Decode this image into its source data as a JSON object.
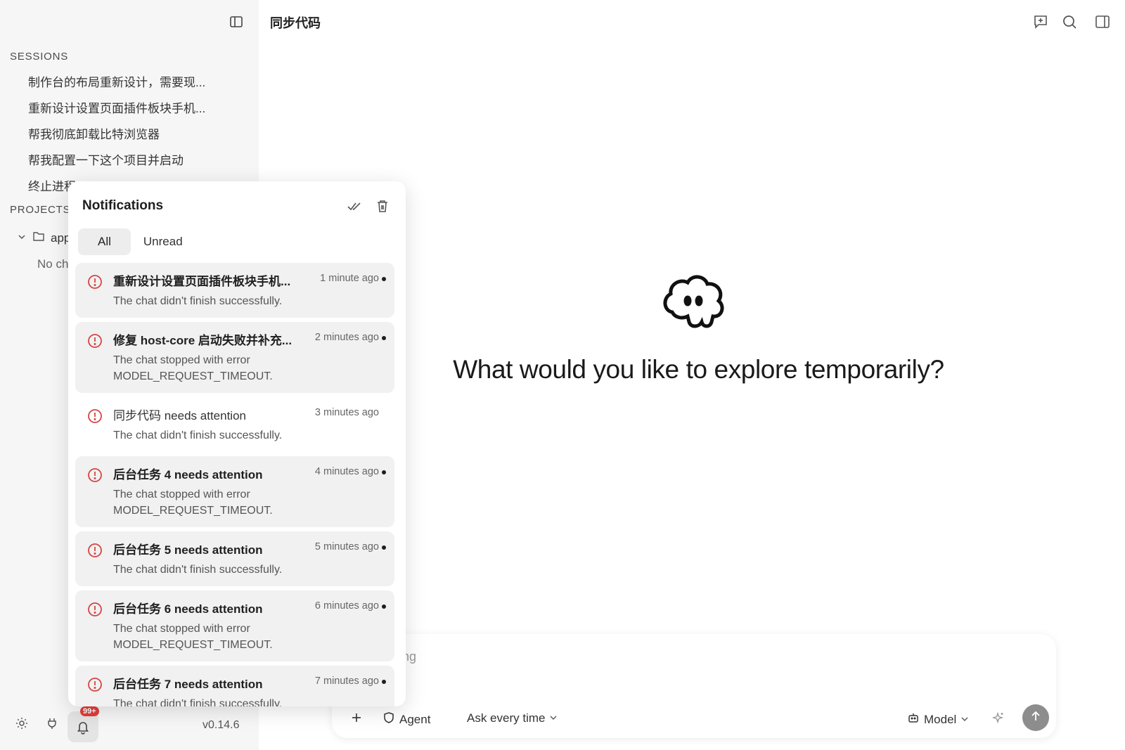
{
  "main": {
    "title": "同步代码",
    "hero": "What would you like to explore temporarily?"
  },
  "sidebar": {
    "sessions_title": "SESSIONS",
    "sessions": [
      "制作台的布局重新设计，需要现...",
      "重新设计设置页面插件板块手机...",
      "帮我彻底卸载比特浏览器",
      "帮我配置一下这个项目并启动",
      "终止进程"
    ],
    "projects_title": "PROJECTS",
    "project_name": "app",
    "no_chats": "No chats",
    "badge": "99+",
    "version": "v0.14.6"
  },
  "composer": {
    "placeholder": "ng",
    "agent": "Agent",
    "ask_mode": "Ask every time",
    "model": "Model"
  },
  "notifications": {
    "title": "Notifications",
    "tabs": [
      "All",
      "Unread"
    ],
    "items": [
      {
        "title": "重新设计设置页面插件板块手机...",
        "body": "The chat didn't finish successfully.",
        "time": "1 minute ago",
        "unread": true
      },
      {
        "title": "修复 host-core 启动失败并补充...",
        "body": "The chat stopped with error MODEL_REQUEST_TIMEOUT.",
        "time": "2 minutes ago",
        "unread": true
      },
      {
        "title": "同步代码 needs attention",
        "body": "The chat didn't finish successfully.",
        "time": "3 minutes ago",
        "unread": false
      },
      {
        "title": "后台任务 4 needs attention",
        "body": "The chat stopped with error MODEL_REQUEST_TIMEOUT.",
        "time": "4 minutes ago",
        "unread": true
      },
      {
        "title": "后台任务 5 needs attention",
        "body": "The chat didn't finish successfully.",
        "time": "5 minutes ago",
        "unread": true
      },
      {
        "title": "后台任务 6 needs attention",
        "body": "The chat stopped with error MODEL_REQUEST_TIMEOUT.",
        "time": "6 minutes ago",
        "unread": true
      },
      {
        "title": "后台任务 7 needs attention",
        "body": "The chat didn't finish successfully.",
        "time": "7 minutes ago",
        "unread": true
      }
    ]
  },
  "colors": {
    "error_icon": "#d64545",
    "badge": "#e23b3b",
    "sidebar_bg": "#f6f6f6"
  }
}
